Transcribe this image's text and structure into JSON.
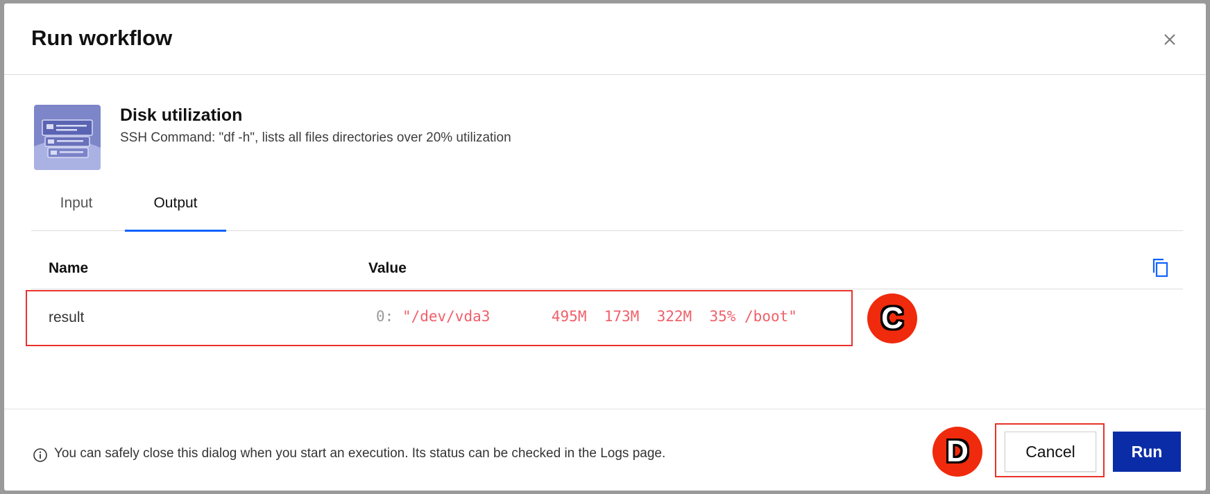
{
  "dialog": {
    "title": "Run workflow"
  },
  "workflow": {
    "name": "Disk utilization",
    "description": "SSH Command: \"df -h\", lists all files directories over 20% utilization"
  },
  "tabs": [
    {
      "label": "Input",
      "active": false
    },
    {
      "label": "Output",
      "active": true
    }
  ],
  "table": {
    "headers": {
      "name": "Name",
      "value": "Value"
    },
    "rows": [
      {
        "name": "result",
        "index": "0:",
        "value": "\"/dev/vda3       495M  173M  322M  35% /boot\""
      }
    ]
  },
  "markers": {
    "c": "C",
    "d": "D"
  },
  "footer": {
    "note": "You can safely close this dialog when you start an execution. Its status can be checked in the Logs page.",
    "cancel_label": "Cancel",
    "run_label": "Run"
  },
  "colors": {
    "accent": "#0f62fe",
    "run_button": "#0a2da7",
    "highlight": "#e8322a",
    "marker": "#f02a0c",
    "string_value": "#f0606a"
  },
  "icons": [
    "close-icon",
    "workflow-thumbnail-icon",
    "copy-icon",
    "info-icon"
  ]
}
